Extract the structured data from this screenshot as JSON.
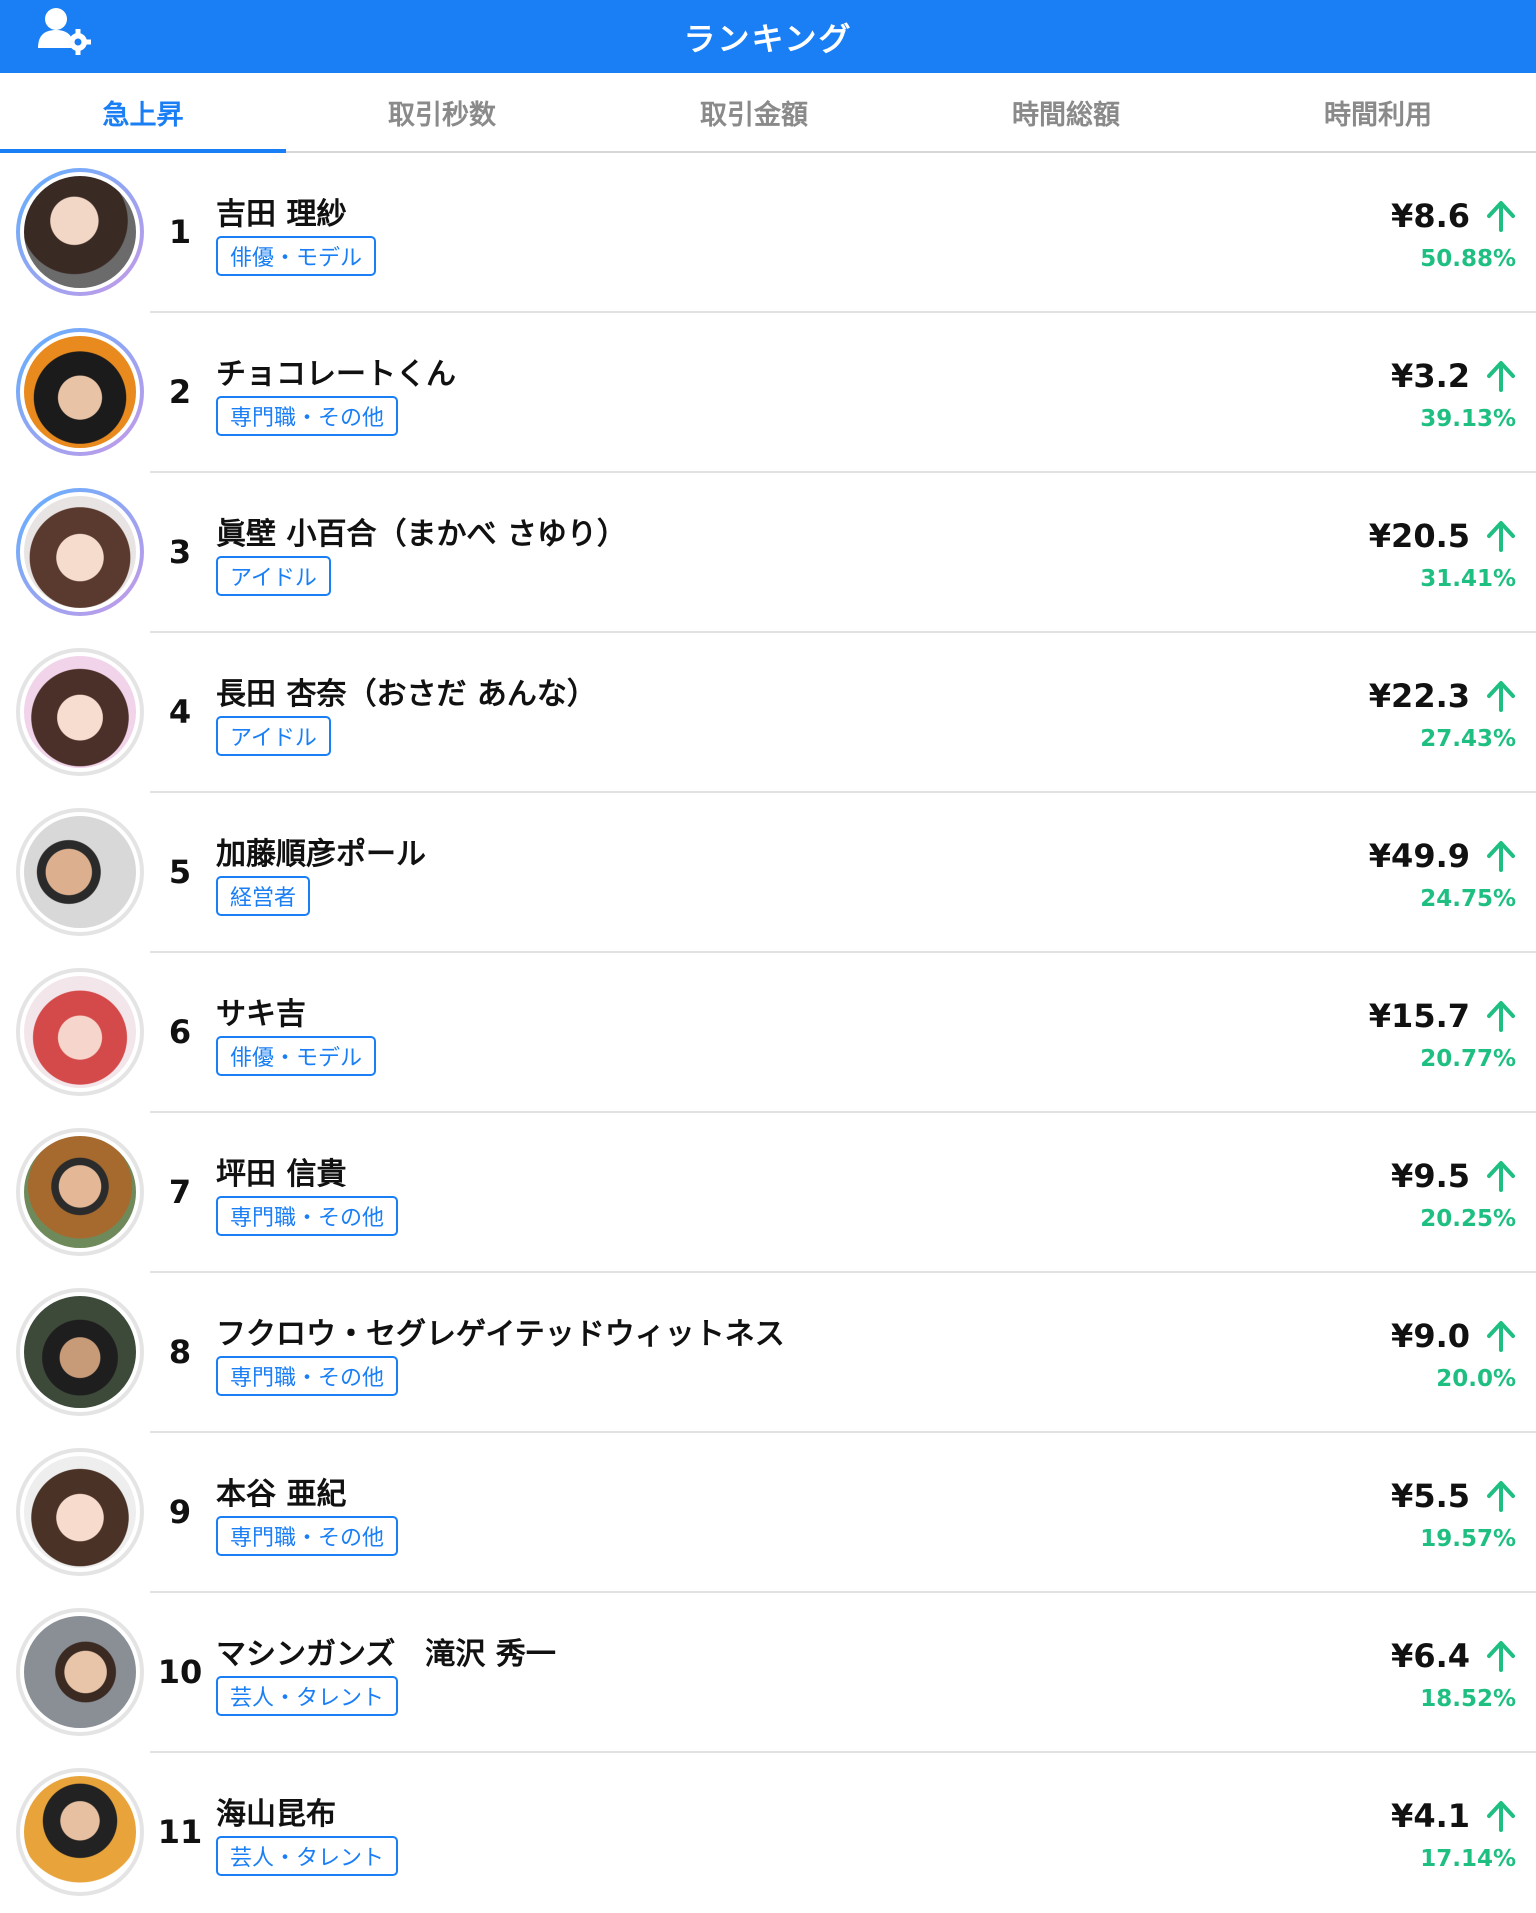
{
  "header": {
    "title": "ランキング"
  },
  "tabs": [
    {
      "label": "急上昇",
      "active": true
    },
    {
      "label": "取引秒数",
      "active": false
    },
    {
      "label": "取引金額",
      "active": false
    },
    {
      "label": "時間総額",
      "active": false
    },
    {
      "label": "時間利用",
      "active": false
    }
  ],
  "colors": {
    "primary": "#1a7ef5",
    "up": "#1fbf82"
  },
  "ranking": [
    {
      "rank": "1",
      "name": "吉田 理紗",
      "tag": "俳優・モデル",
      "price": "¥8.6",
      "change": "50.88%"
    },
    {
      "rank": "2",
      "name": "チョコレートくん",
      "tag": "専門職・その他",
      "price": "¥3.2",
      "change": "39.13%"
    },
    {
      "rank": "3",
      "name": "眞壁 小百合（まかべ さゆり）",
      "tag": "アイドル",
      "price": "¥20.5",
      "change": "31.41%"
    },
    {
      "rank": "4",
      "name": "長田 杏奈（おさだ あんな）",
      "tag": "アイドル",
      "price": "¥22.3",
      "change": "27.43%"
    },
    {
      "rank": "5",
      "name": "加藤順彦ポール",
      "tag": "経営者",
      "price": "¥49.9",
      "change": "24.75%"
    },
    {
      "rank": "6",
      "name": "サキ吉",
      "tag": "俳優・モデル",
      "price": "¥15.7",
      "change": "20.77%"
    },
    {
      "rank": "7",
      "name": "坪田 信貴",
      "tag": "専門職・その他",
      "price": "¥9.5",
      "change": "20.25%"
    },
    {
      "rank": "8",
      "name": "フクロウ・セグレゲイテッドウィットネス",
      "tag": "専門職・その他",
      "price": "¥9.0",
      "change": "20.0%"
    },
    {
      "rank": "9",
      "name": "本谷 亜紀",
      "tag": "専門職・その他",
      "price": "¥5.5",
      "change": "19.57%"
    },
    {
      "rank": "10",
      "name": "マシンガンズ　滝沢 秀一",
      "tag": "芸人・タレント",
      "price": "¥6.4",
      "change": "18.52%"
    },
    {
      "rank": "11",
      "name": "海山昆布",
      "tag": "芸人・タレント",
      "price": "¥4.1",
      "change": "17.14%"
    }
  ]
}
